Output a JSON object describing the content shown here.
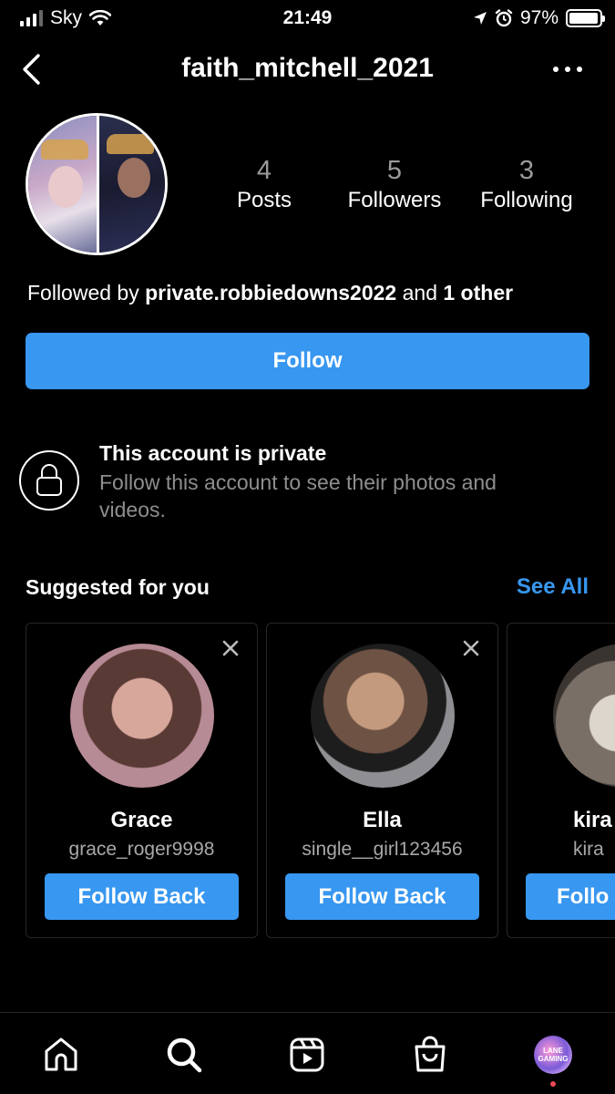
{
  "status_bar": {
    "carrier": "Sky",
    "time": "21:49",
    "battery": "97%",
    "battery_level": 0.97,
    "signal_bars": 3
  },
  "header": {
    "title": "faith_mitchell_2021",
    "back_icon": "chevron-left-icon",
    "more_icon": "more-horizontal-icon"
  },
  "profile": {
    "stats": [
      {
        "value": "4",
        "label": "Posts"
      },
      {
        "value": "5",
        "label": "Followers"
      },
      {
        "value": "3",
        "label": "Following"
      }
    ],
    "followed_by_prefix": "Followed by",
    "followed_by_user": "private.robbiedowns2022",
    "followed_by_mid": "and",
    "followed_by_others": "1 other",
    "follow_label": "Follow"
  },
  "private_notice": {
    "title": "This account is private",
    "description": "Follow this account to see their photos and videos."
  },
  "suggested": {
    "title": "Suggested for you",
    "see_all": "See All",
    "cards": [
      {
        "name": "Grace",
        "username": "grace_roger9998",
        "button": "Follow Back"
      },
      {
        "name": "Ella",
        "username": "single__girl123456",
        "button": "Follow Back"
      },
      {
        "name": "kira",
        "username": "kira",
        "button": "Follo"
      }
    ]
  },
  "bottom_nav": {
    "items": [
      "home-icon",
      "search-icon",
      "reels-icon",
      "shop-icon",
      "profile-avatar"
    ],
    "profile_avatar_text": "LANE GAMING"
  },
  "colors": {
    "accent": "#3897f0",
    "background": "#000000",
    "muted_text": "#8e8e8e",
    "notification_dot": "#ed4956"
  }
}
